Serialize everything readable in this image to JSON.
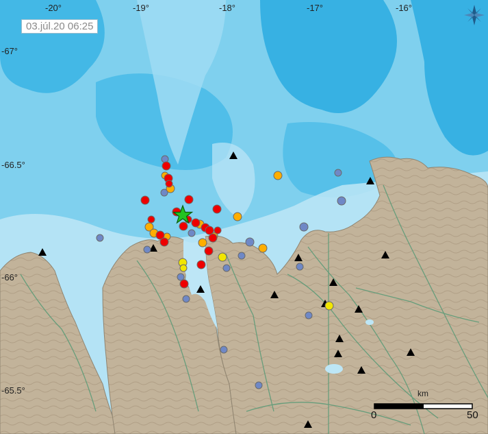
{
  "map": {
    "timestamp": "03.júl.20  06:25",
    "lon_labels": [
      "-20°",
      "-19°",
      "-18°",
      "-17°",
      "-16°"
    ],
    "lat_labels": [
      "-67°",
      "-66.5°",
      "-66°",
      "-65.5°"
    ],
    "scale": {
      "unit": "km",
      "start": "0",
      "end": "50"
    },
    "compass_icon": "compass-rose-icon",
    "colors": {
      "sea_deep": "#1fa6dc",
      "sea_mid": "#44b8e6",
      "sea_light": "#7fd0ee",
      "sea_shallow": "#bde6f6",
      "land": "#c2b39a",
      "land_dark": "#a99a82",
      "roads": "#5e9b78",
      "quake_recent": "#ee0000",
      "quake_day": "#ffae00",
      "quake_two_days": "#f2e600",
      "quake_older": "#6f88c6",
      "mainshock": "#22c322"
    }
  }
}
